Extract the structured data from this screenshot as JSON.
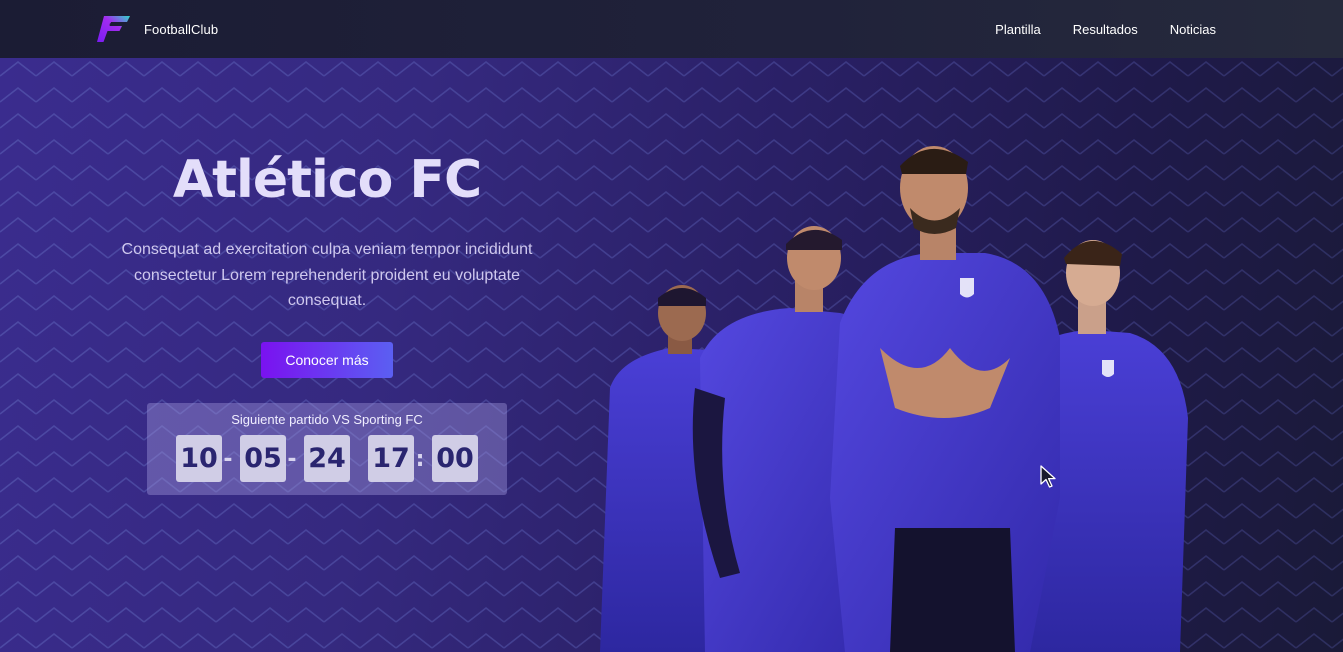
{
  "nav": {
    "brand": "FootballClub",
    "links": [
      "Plantilla",
      "Resultados",
      "Noticias"
    ]
  },
  "hero": {
    "title": "Atlético FC",
    "description": "Consequat ad exercitation culpa veniam tempor incididunt consectetur Lorem reprehenderit proident eu voluptate consequat.",
    "cta_label": "Conocer más"
  },
  "countdown": {
    "label": "Siguiente partido VS Sporting FC",
    "days": "10",
    "sep1": "-",
    "months": "05",
    "sep2": "-",
    "year": "24",
    "hours": "17",
    "sep3": ":",
    "minutes": "00"
  },
  "colors": {
    "accent_start": "#7a12f0",
    "accent_end": "#5b5ff2",
    "nav_bg": "#1b1c34",
    "hero_bg": "#35297f",
    "jersey": "#3f35c4"
  },
  "icons": {
    "logo": "fc-logo-icon",
    "cursor": "mouse-pointer-icon"
  }
}
